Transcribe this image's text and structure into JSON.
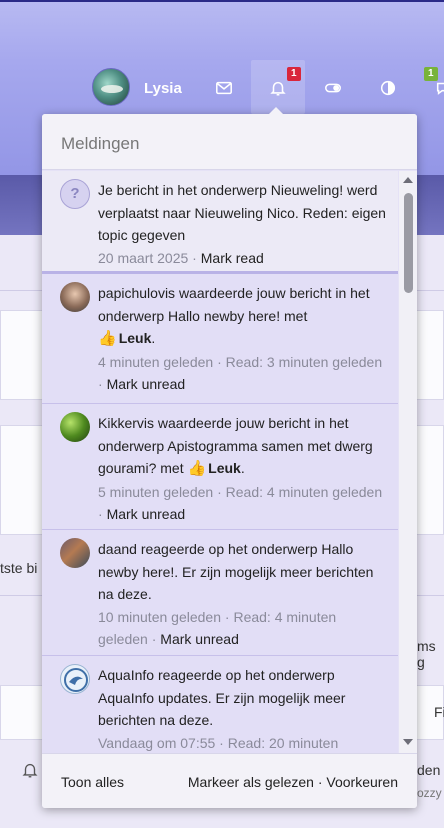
{
  "header": {
    "username": "Lysia",
    "notifications_badge": "1",
    "conversations_badge": "1"
  },
  "background": {
    "left_snippet": "tste bi",
    "right_snippet_1": "ms g",
    "right_snippet_2": "Fi",
    "right_snippet_3": "den",
    "right_snippet_4": "ozzy"
  },
  "dropdown": {
    "title": "Meldingen",
    "items": [
      {
        "text": "Je bericht in het onderwerp Nieuweling! werd verplaatst naar Nieuweling Nico. Reden: eigen topic gegeven",
        "time": "20 maart 2025",
        "action": "Mark read"
      },
      {
        "text_pre": "papichulovis waardeerde jouw bericht in het onderwerp Hallo newby here! met",
        "reaction": "Leuk",
        "time": "4 minuten geleden",
        "read": "Read: 3 minuten geleden",
        "action": "Mark unread"
      },
      {
        "text_pre": "Kikkervis waardeerde jouw bericht in het onderwerp Apistogramma samen met dwerg gourami? met",
        "reaction": "Leuk",
        "time": "5 minuten geleden",
        "read": "Read: 4 minuten geleden",
        "action": "Mark unread"
      },
      {
        "text": "daand reageerde op het onderwerp Hallo newby here!. Er zijn mogelijk meer berichten na deze.",
        "time": "10 minuten geleden",
        "read": "Read: 4 minuten geleden",
        "action": "Mark unread"
      },
      {
        "text": "AquaInfo reageerde op het onderwerp AquaInfo updates. Er zijn mogelijk meer berichten na deze.",
        "time": "Vandaag om 07:55",
        "read": "Read: 20 minuten"
      }
    ],
    "footer": {
      "show_all": "Toon alles",
      "mark_all_read": "Markeer als gelezen",
      "separator": "·",
      "preferences": "Voorkeuren"
    }
  },
  "colors": {
    "header_gradient_top": "#b8baf2",
    "unread_bg": "#e2def6",
    "badge_red": "#d9263b",
    "badge_green": "#78b33a"
  }
}
